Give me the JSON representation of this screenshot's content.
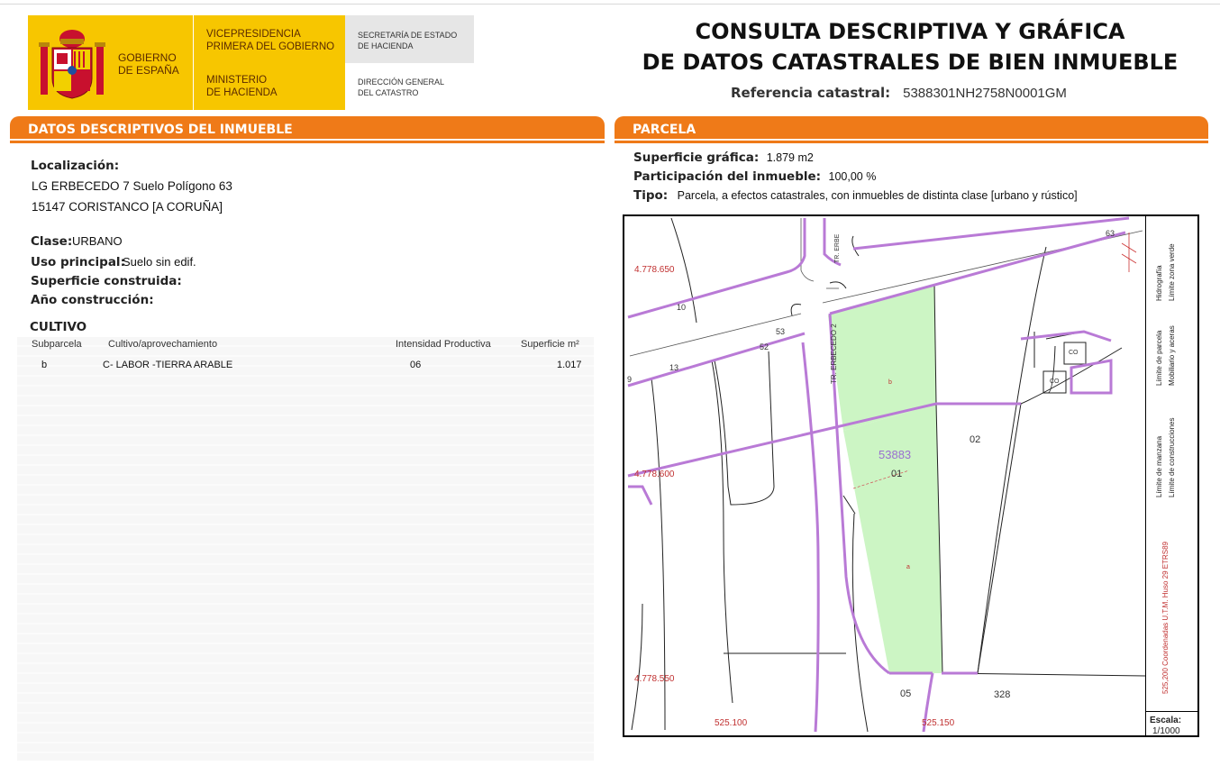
{
  "header": {
    "logo": {
      "gobierno": "GOBIERNO\nDE ESPAÑA",
      "vicepresidencia": "VICEPRESIDENCIA\nPRIMERA DEL GOBIERNO",
      "ministerio": "MINISTERIO\nDE HACIENDA",
      "secretaria": "SECRETARÍA DE ESTADO\nDE HACIENDA",
      "direccion": "DIRECCIÓN GENERAL\nDEL CATASTRO",
      "shield_icon": "coat-of-arms-icon"
    },
    "title_line1": "CONSULTA DESCRIPTIVA Y GRÁFICA",
    "title_line2": "DE DATOS CATASTRALES DE BIEN INMUEBLE",
    "ref_label": "Referencia catastral:",
    "ref_value": "5388301NH2758N0001GM"
  },
  "colors": {
    "orange": "#ef7a18",
    "yellow": "#f7c600",
    "parcel_fill": "#ccf5c4",
    "boundary": "#b97ad6"
  },
  "descriptivos": {
    "heading": "DATOS DESCRIPTIVOS DEL INMUEBLE",
    "localizacion_label": "Localización:",
    "localizacion_line1": "LG ERBECEDO 7 Suelo Polígono 63",
    "localizacion_line2": "15147 CORISTANCO [A CORUÑA]",
    "clase_label": "Clase:",
    "clase_value": "URBANO",
    "uso_label": "Uso principal:",
    "uso_value": "Suelo sin edif.",
    "superficie_label": "Superficie construida:",
    "anio_label": "Año construcción:"
  },
  "cultivo": {
    "heading": "CULTIVO",
    "columns": [
      "Subparcela",
      "Cultivo/aprovechamiento",
      "Intensidad Productiva",
      "Superficie m²"
    ],
    "rows": [
      {
        "subparcela": "b",
        "cultivo": "C- LABOR -TIERRA ARABLE",
        "intensidad": "06",
        "superficie": "1.017"
      }
    ]
  },
  "parcela": {
    "heading": "PARCELA",
    "superficie_label": "Superficie gráfica:",
    "superficie_value": "1.879 m2",
    "participacion_label": "Participación del inmueble:",
    "participacion_value": "100,00 %",
    "tipo_label": "Tipo:",
    "tipo_value": "Parcela, a efectos catastrales, con inmuebles de distinta clase [urbano y rústico]"
  },
  "map": {
    "coords": {
      "y1": "4.778.650",
      "y2": "4.778.600",
      "y3": "4.778.550",
      "x1": "525.100",
      "x2": "525.150"
    },
    "labels": {
      "parcel_ref": "53883",
      "p01": "01",
      "p02": "02",
      "p05": "05",
      "p328": "328",
      "n10": "10",
      "n13": "13",
      "n52": "52",
      "n53": "53",
      "n63": "63",
      "n9": "9",
      "co1": "CO",
      "co2": "CO",
      "sub_b": "b",
      "sub_a": "a",
      "street1": "TR. ERBECEDO 2",
      "street2": "TR. ERBE"
    },
    "legend": {
      "limite_parcela": "Límite de parcela",
      "mobiliario": "Mobiliario y aceras",
      "hidrografia": "Hidrografía",
      "zona_verde": "Límite zona verde",
      "limite_manzana": "Límite de manzana",
      "limite_construcciones": "Límite de construcciones",
      "coords_note": "525,200 Coordenadas U.T.M. Huso 29 ETRS89",
      "escala_label": "Escala:",
      "escala_value": "1/1000"
    }
  }
}
